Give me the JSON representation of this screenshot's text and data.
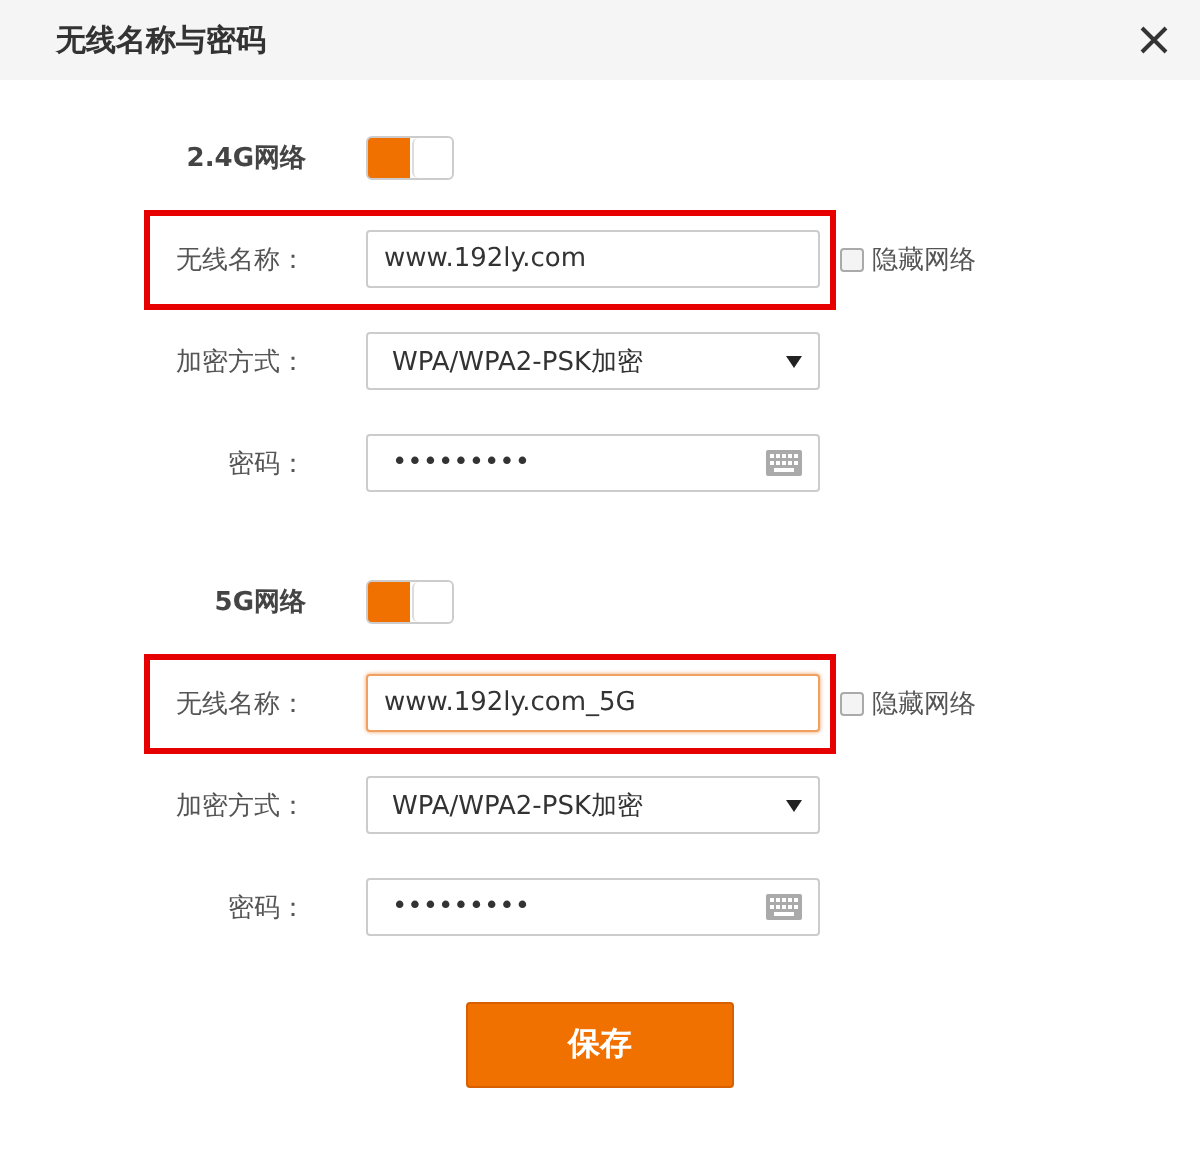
{
  "dialog": {
    "title": "无线名称与密码"
  },
  "networks": [
    {
      "label": "2.4G网络",
      "on": true,
      "ssid": {
        "label": "无线名称：",
        "value": "www.192ly.com",
        "highlighted": true,
        "focused": false
      },
      "hide": {
        "label": "隐藏网络",
        "checked": false
      },
      "security": {
        "label": "加密方式：",
        "value": "WPA/WPA2-PSK加密"
      },
      "password": {
        "label": "密码：",
        "value": "•••••••••"
      }
    },
    {
      "label": "5G网络",
      "on": true,
      "ssid": {
        "label": "无线名称：",
        "value": "www.192ly.com_5G",
        "highlighted": true,
        "focused": true
      },
      "hide": {
        "label": "隐藏网络",
        "checked": false
      },
      "security": {
        "label": "加密方式：",
        "value": "WPA/WPA2-PSK加密"
      },
      "password": {
        "label": "密码：",
        "value": "•••••••••"
      }
    }
  ],
  "save_button": "保存"
}
